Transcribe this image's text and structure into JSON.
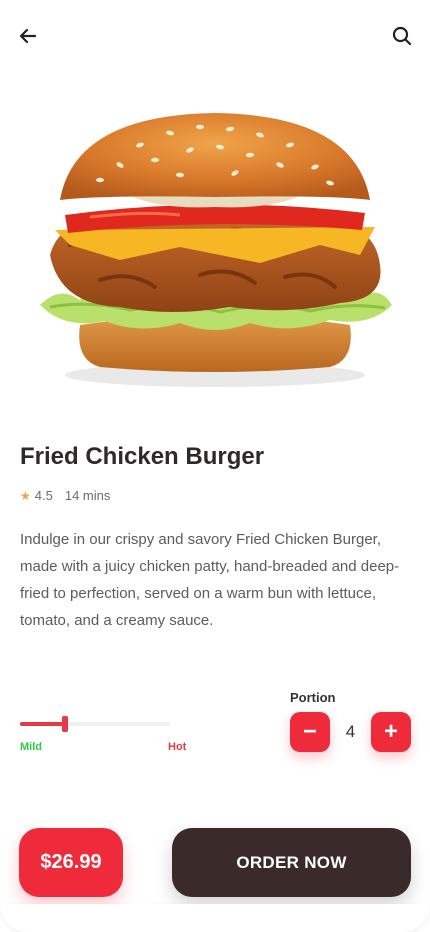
{
  "header": {
    "back_icon": "arrow-left-icon",
    "search_icon": "search-icon"
  },
  "product": {
    "image_icon": "burger-image",
    "title": "Fried Chicken Burger",
    "rating": "4.5",
    "time": "14 mins",
    "description": "Indulge in our crispy and savory Fried Chicken Burger, made with a juicy chicken patty, hand-breaded and deep-fried to perfection, served on a warm bun with lettuce, tomato, and a creamy sauce."
  },
  "spicy": {
    "level": 0.3,
    "min_label": "Mild",
    "max_label": "Hot",
    "min_color": "#2ecc40",
    "max_color": "#e63946"
  },
  "portion": {
    "label": "Portion",
    "value": "4",
    "minus_symbol": "−",
    "plus_symbol": "+"
  },
  "footer": {
    "price": "$26.99",
    "order_label": "ORDER NOW"
  },
  "colors": {
    "accent": "#ef2a3a",
    "dark": "#3b2a2a"
  }
}
